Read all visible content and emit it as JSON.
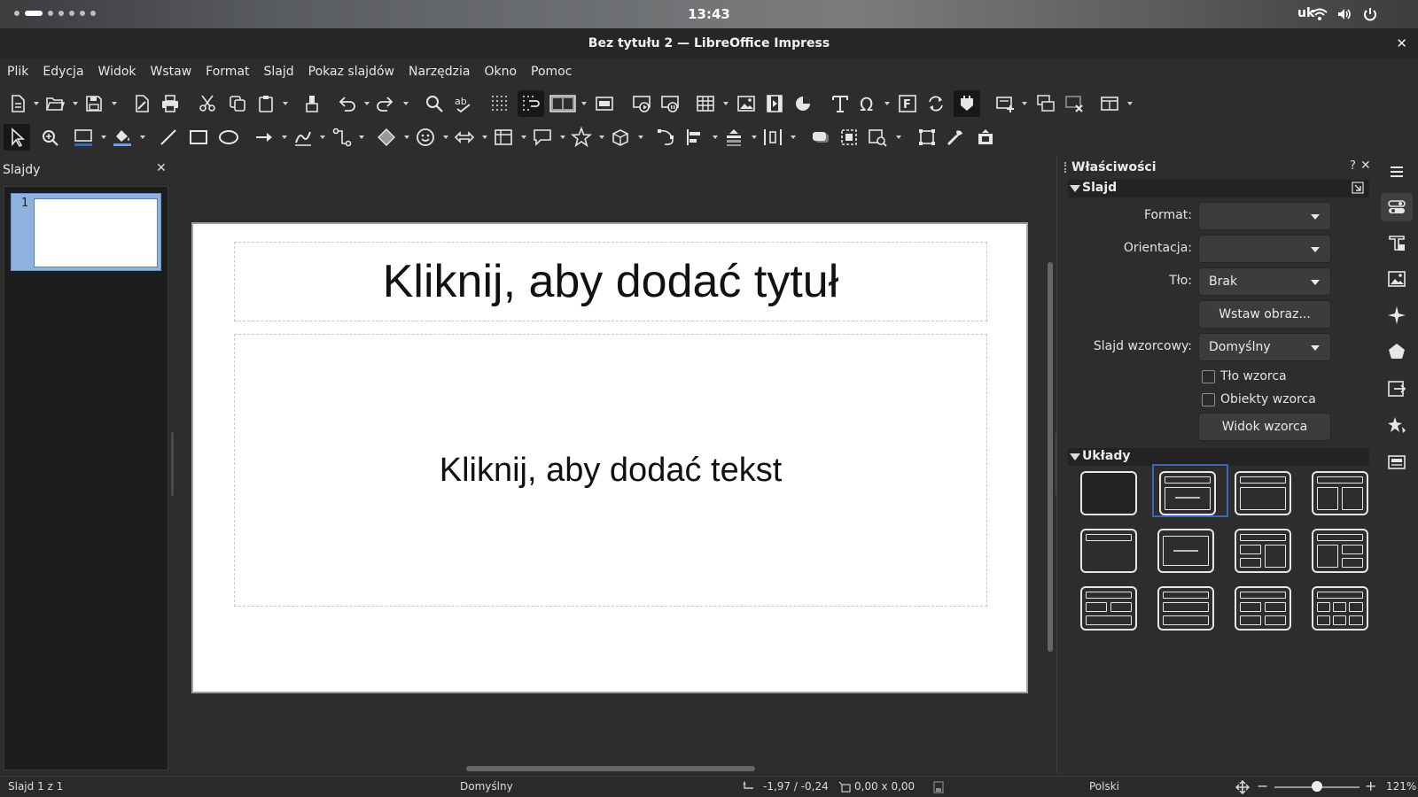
{
  "topbar": {
    "clock": "13:43",
    "keyboard_layout": "uk",
    "workspaces": 7,
    "active_workspace": 1
  },
  "window": {
    "title": "Bez tytułu 2 — LibreOffice Impress",
    "close_glyph": "✕"
  },
  "menu": [
    "Plik",
    "Edycja",
    "Widok",
    "Wstaw",
    "Format",
    "Slajd",
    "Pokaz slajdów",
    "Narzędzia",
    "Okno",
    "Pomoc"
  ],
  "slides_pane": {
    "title": "Slajdy",
    "close_glyph": "✕",
    "slides": [
      {
        "number": "1"
      }
    ]
  },
  "slide": {
    "title_placeholder": "Kliknij, aby dodać tytuł",
    "body_placeholder": "Kliknij, aby dodać tekst"
  },
  "properties": {
    "title": "Właściwości",
    "help_glyph": "?",
    "close_glyph": "✕",
    "slide_section": {
      "header": "Slajd",
      "format_label": "Format:",
      "format_value": "",
      "orientation_label": "Orientacja:",
      "orientation_value": "",
      "background_label": "Tło:",
      "background_value": "Brak",
      "insert_image_button": "Wstaw obraz...",
      "master_slide_label": "Slajd wzorcowy:",
      "master_slide_value": "Domyślny",
      "master_background_checkbox": "Tło wzorca",
      "master_objects_checkbox": "Obiekty wzorca",
      "master_view_button": "Widok wzorca"
    },
    "layouts_section": {
      "header": "Układy",
      "selected_index": 1
    }
  },
  "statusbar": {
    "slide_info": "Slajd 1 z 1",
    "master_name": "Domyślny",
    "position": "-1,97 / -0,24",
    "size": "0,00 x 0,00",
    "language": "Polski",
    "zoom_label": "121%",
    "zoom_fraction": 0.5
  },
  "colors": {
    "selection_border": "#3568b8",
    "thumbnail_highlight": "#8fb3df"
  }
}
